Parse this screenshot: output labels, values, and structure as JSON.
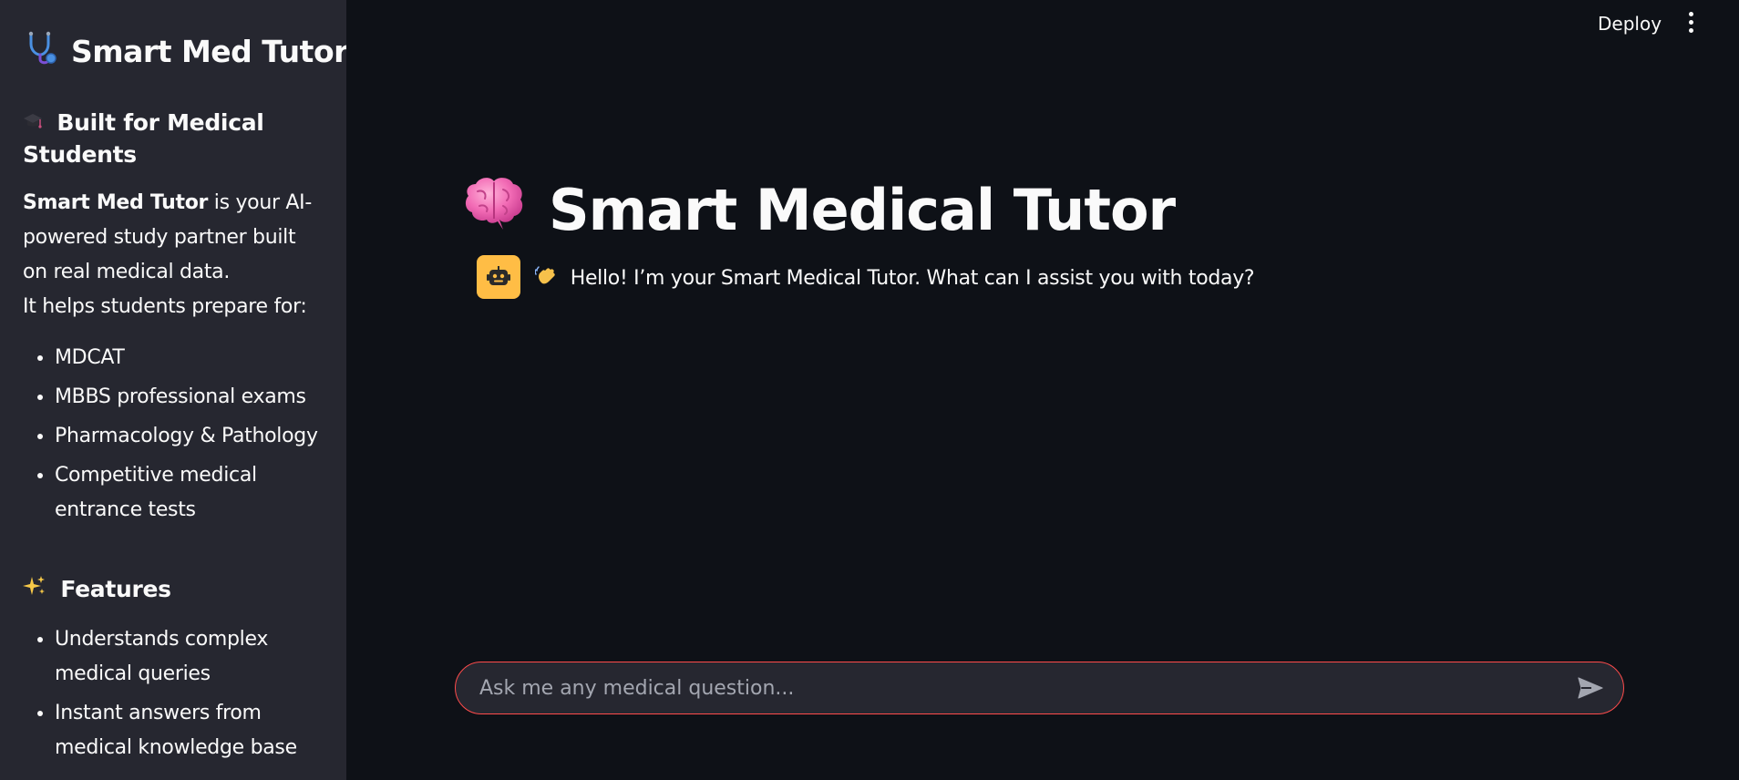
{
  "sidebar": {
    "title": "Smart Med Tutor",
    "section1": {
      "heading": "Built for Medical Students",
      "intro_bold": "Smart Med Tutor",
      "intro_rest": " is your AI-powered study partner built on real medical data.",
      "intro_line2": "It helps students prepare for:",
      "items": [
        "MDCAT",
        "MBBS professional exams",
        "Pharmacology & Pathology",
        "Competitive medical entrance tests"
      ]
    },
    "section2": {
      "heading": "Features",
      "items": [
        "Understands complex medical queries",
        "Instant answers from medical knowledge base"
      ]
    }
  },
  "topbar": {
    "deploy_label": "Deploy"
  },
  "main": {
    "title": "Smart Medical Tutor",
    "message": "Hello! I’m your Smart Medical Tutor. What can I assist you with today?"
  },
  "chat_input": {
    "placeholder": "Ask me any medical question..."
  },
  "colors": {
    "background": "#0e1117",
    "sidebar": "#262730",
    "accent": "#ff4b4b",
    "avatar": "#ffbd45"
  }
}
